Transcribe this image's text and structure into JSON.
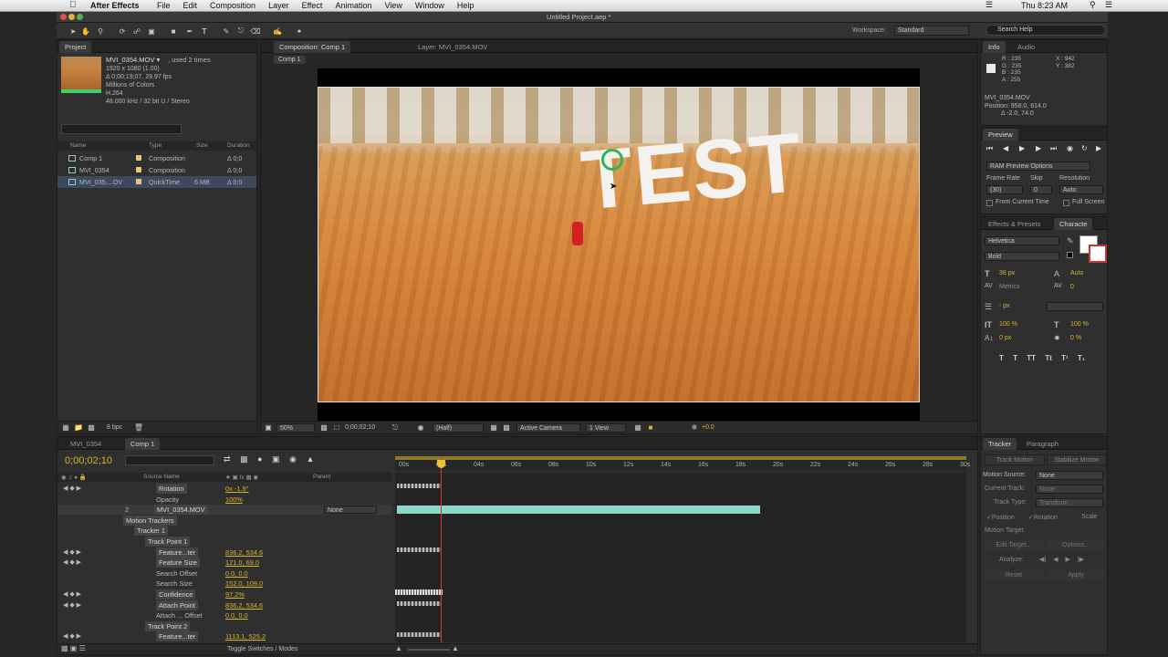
{
  "menubar": {
    "app": "After Effects",
    "menus": [
      "File",
      "Edit",
      "Composition",
      "Layer",
      "Effect",
      "Animation",
      "View",
      "Window",
      "Help"
    ],
    "clock": "Thu 8:23 AM"
  },
  "window_title": "Untitled Project.aep *",
  "workspace": {
    "label": "Workspace:",
    "value": "Standard"
  },
  "search_help": "Search Help",
  "project": {
    "tab": "Project",
    "clip_name": "MVI_0354.MOV ▾",
    "used": ", used 2 times",
    "info_lines": [
      "1920 x 1080 (1.00)",
      "Δ 0;00;19;07, 29.97 fps",
      "Millions of Colors",
      "H.264",
      "48.000 kHz / 32 bit U / Stereo"
    ],
    "columns": [
      "Name",
      "Type",
      "Size",
      "Duration"
    ],
    "items": [
      {
        "name": "Comp 1",
        "type": "Composition",
        "size": "",
        "duration": "Δ 0;0"
      },
      {
        "name": "MVI_0354",
        "type": "Composition",
        "size": "",
        "duration": "Δ 0;0"
      },
      {
        "name": "MVI_035....OV",
        "type": "QuickTime",
        "size": "6 MB",
        "duration": "Δ 0;0"
      }
    ],
    "bpc": "8 bpc"
  },
  "viewer": {
    "comp_tab": "Composition: Comp 1",
    "layer_tab": "Layer: MVI_0354.MOV",
    "breadcrumb": "Comp 1",
    "overlay_text": "TEST",
    "zoom": "50%",
    "timecode": "0;00;02;10",
    "resolution": "(Half)",
    "camera": "Active Camera",
    "views": "1 View",
    "exposure": "+0.0"
  },
  "info": {
    "tab": "Info",
    "tab2": "Audio",
    "r": "R : 235",
    "g": "G : 235",
    "b": "B : 235",
    "a": "A : 255",
    "x": "X : 942",
    "y": "Y : 382",
    "layer": "MVI_0354.MOV",
    "position": "Position: 958.0, 614.0",
    "delta": "Δ -2.0, 74.0"
  },
  "preview": {
    "tab": "Preview",
    "ram": "RAM Preview Options",
    "frame_rate_label": "Frame Rate",
    "skip_label": "Skip",
    "resolution_label": "Resolution",
    "frame_rate": "(30)",
    "skip": "0",
    "resolution": "Auto",
    "from_current": "From Current Time",
    "full_screen": "Full Screen"
  },
  "character": {
    "tab1": "Effects & Presets",
    "tab2": "Characte",
    "font": "Helvetica",
    "style": "Bold",
    "size": "36 px",
    "leading": "Auto",
    "kerning": "Metrics",
    "tracking": "0",
    "stroke": "- px",
    "vscale": "100 %",
    "hscale": "100 %",
    "baseline": "0 px",
    "tsume": "0 %"
  },
  "tracker": {
    "tab1": "Tracker",
    "tab2": "Paragraph",
    "track_motion": "Track Motion",
    "stabilize_motion": "Stabilize Motion",
    "motion_source_label": "Motion Source:",
    "motion_source": "None",
    "current_track_label": "Current Track:",
    "current_track": "None",
    "track_type_label": "Track Type:",
    "track_type": "Transform",
    "position": "Position",
    "rotation": "Rotation",
    "scale": "Scale",
    "motion_target": "Motion Target:",
    "edit_target": "Edit Target...",
    "options": "Options...",
    "analyze": "Analyze:",
    "reset": "Reset",
    "apply": "Apply"
  },
  "timeline": {
    "tab1": "MVI_0354",
    "tab2": "Comp 1",
    "timecode": "0;00;02;10",
    "source_name_col": "Source Name",
    "parent_col": "Parent",
    "ruler": [
      "00s",
      "02s",
      "04s",
      "06s",
      "08s",
      "10s",
      "12s",
      "14s",
      "16s",
      "18s",
      "20s",
      "22s",
      "24s",
      "26s",
      "28s",
      "30s"
    ],
    "toggle_label": "Toggle Switches / Modes",
    "rows": [
      {
        "label": "Rotation",
        "value": "0x -1.9°",
        "indent": 1,
        "kind": "prop"
      },
      {
        "label": "Opacity",
        "value": "100%",
        "indent": 1,
        "kind": "prop"
      },
      {
        "label": "MVI_0354.MOV",
        "value": "",
        "indent": 0,
        "kind": "layer",
        "num": "2",
        "parent": "None"
      },
      {
        "label": "Motion Trackers",
        "value": "",
        "indent": 1,
        "kind": "group"
      },
      {
        "label": "Tracker 1",
        "value": "",
        "indent": 2,
        "kind": "group"
      },
      {
        "label": "Track Point 1",
        "value": "",
        "indent": 3,
        "kind": "group"
      },
      {
        "label": "Feature...ter",
        "value": "836.2, 534.6",
        "indent": 4,
        "kind": "prop"
      },
      {
        "label": "Feature Size",
        "value": "121.0, 69.0",
        "indent": 4,
        "kind": "prop"
      },
      {
        "label": "Search Offset",
        "value": "0.0, 0.0",
        "indent": 4,
        "kind": "prop"
      },
      {
        "label": "Search Size",
        "value": "152.0, 109.0",
        "indent": 4,
        "kind": "prop"
      },
      {
        "label": "Confidence",
        "value": "97.2%",
        "indent": 4,
        "kind": "prop"
      },
      {
        "label": "Attach Point",
        "value": "836.2, 534.6",
        "indent": 4,
        "kind": "prop"
      },
      {
        "label": "Attach ... Offset",
        "value": "0.0, 0.0",
        "indent": 4,
        "kind": "prop"
      },
      {
        "label": "Track Point 2",
        "value": "",
        "indent": 3,
        "kind": "group"
      },
      {
        "label": "Feature...ter",
        "value": "1113.1, 525.2",
        "indent": 4,
        "kind": "prop"
      }
    ]
  }
}
